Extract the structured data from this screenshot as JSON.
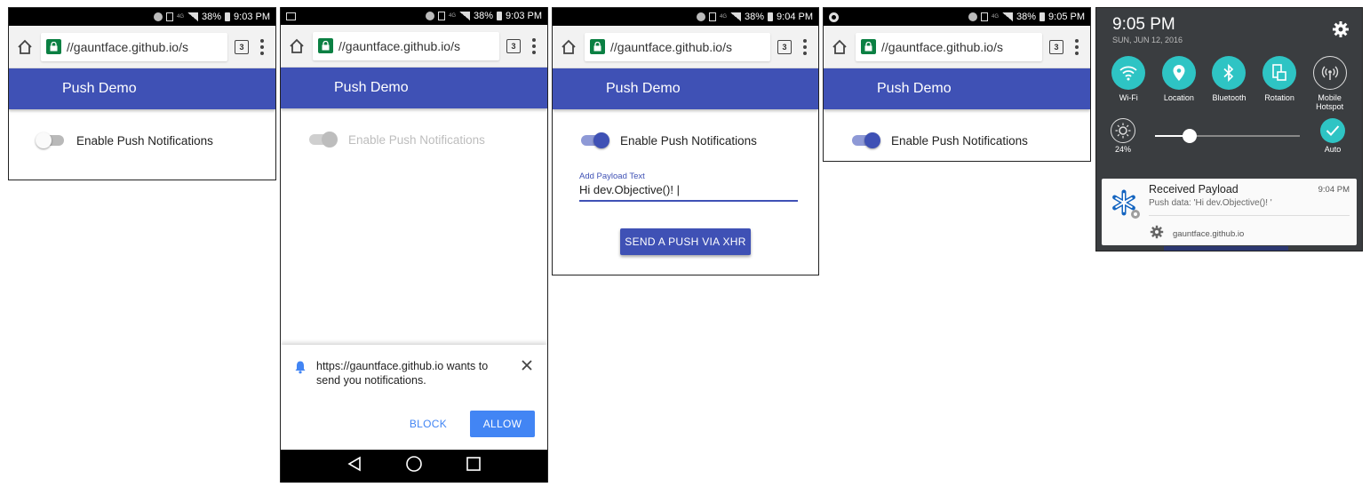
{
  "status": {
    "battery": "38%",
    "network": "4G",
    "times": [
      "9:03 PM",
      "9:03 PM",
      "9:04 PM",
      "9:05 PM"
    ]
  },
  "browser": {
    "url": "//gauntface.github.io/s",
    "tab_count": "3"
  },
  "app": {
    "title": "Push Demo",
    "toggle_label": "Enable Push Notifications",
    "payload_label": "Add Payload Text",
    "payload_value": "Hi dev.Objective()! |",
    "send_button": "SEND A PUSH VIA XHR"
  },
  "permission": {
    "message": "https://gauntface.github.io wants to send you notifications.",
    "block": "BLOCK",
    "allow": "ALLOW"
  },
  "shade": {
    "time": "9:05 PM",
    "date": "SUN, JUN 12, 2016",
    "quick_settings": [
      {
        "label": "Wi-Fi",
        "icon": "wifi-icon"
      },
      {
        "label": "Location",
        "icon": "location-icon"
      },
      {
        "label": "Bluetooth",
        "icon": "bluetooth-icon"
      },
      {
        "label": "Rotation",
        "icon": "rotation-icon"
      },
      {
        "label": "Mobile Hotspot",
        "icon": "hotspot-icon"
      }
    ],
    "brightness": "24%",
    "brightness_level": 0.24,
    "auto_label": "Auto"
  },
  "notification": {
    "title": "Received Payload",
    "time": "9:04 PM",
    "body": "Push data: 'Hi dev.Objective()! '",
    "site": "gauntface.github.io"
  },
  "colors": {
    "primary": "#3f51b5",
    "allow": "#4285f4",
    "teal": "#2ec4c4",
    "lock": "#0b8043"
  }
}
